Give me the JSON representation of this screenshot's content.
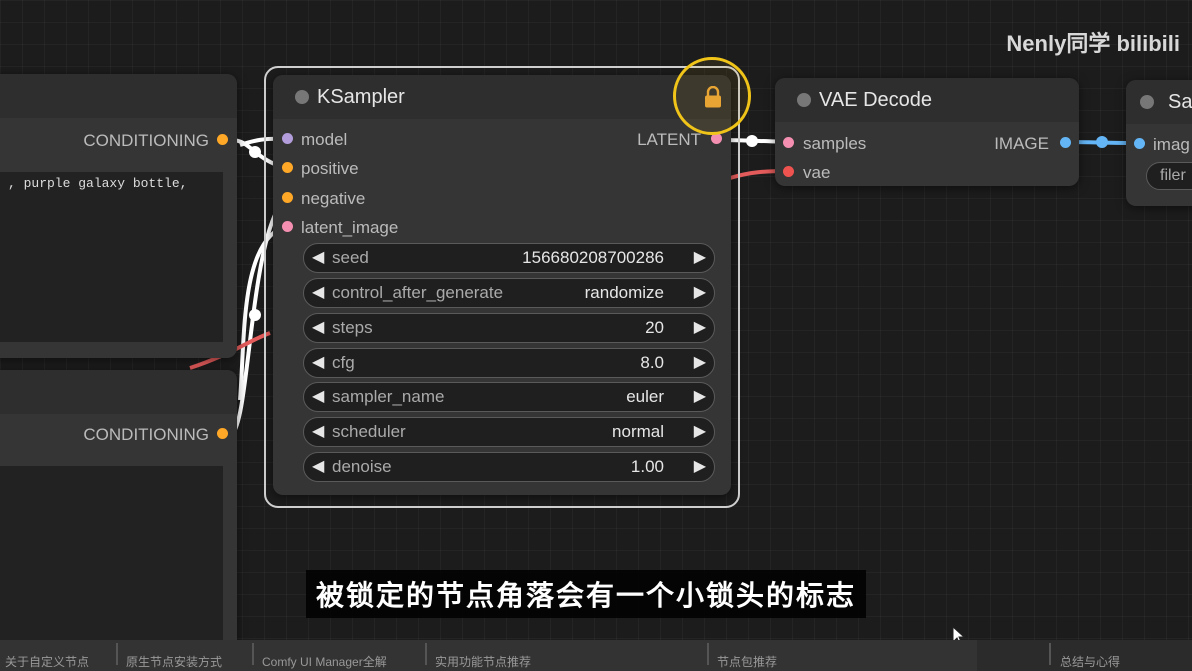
{
  "left_nodes": {
    "top": {
      "output_label": "CONDITIONING",
      "prompt_text": ", purple galaxy bottle,"
    },
    "bottom": {
      "output_label": "CONDITIONING"
    }
  },
  "ksampler": {
    "title": "KSampler",
    "inputs": [
      {
        "label": "model",
        "color": "#b39ddb"
      },
      {
        "label": "positive",
        "color": "#ffa726"
      },
      {
        "label": "negative",
        "color": "#ffa726"
      },
      {
        "label": "latent_image",
        "color": "#f48fb1"
      }
    ],
    "output": {
      "label": "LATENT",
      "color": "#f48fb1"
    },
    "widgets": [
      {
        "label": "seed",
        "value": "156680208700286"
      },
      {
        "label": "control_after_generate",
        "value": "randomize"
      },
      {
        "label": "steps",
        "value": "20"
      },
      {
        "label": "cfg",
        "value": "8.0"
      },
      {
        "label": "sampler_name",
        "value": "euler"
      },
      {
        "label": "scheduler",
        "value": "normal"
      },
      {
        "label": "denoise",
        "value": "1.00"
      }
    ],
    "lock_icon": "lock-icon",
    "highlight_color": "#f0c419"
  },
  "vae_decode": {
    "title": "VAE Decode",
    "inputs": [
      {
        "label": "samples",
        "color": "#f48fb1"
      },
      {
        "label": "vae",
        "color": "#ef5350"
      }
    ],
    "output": {
      "label": "IMAGE",
      "color": "#64b5f6"
    }
  },
  "save_node": {
    "title": "Sa",
    "input": {
      "label": "imag",
      "color": "#64b5f6"
    },
    "field": "filer"
  },
  "watermark": "Nenly同学 bilibili",
  "subtitle": "被锁定的节点角落会有一个小锁头的标志",
  "chapters": [
    "关于自定义节点",
    "原生节点安装方式",
    "Comfy UI Manager全解",
    "实用功能节点推荐",
    "节点包推荐",
    "总结与心得"
  ]
}
